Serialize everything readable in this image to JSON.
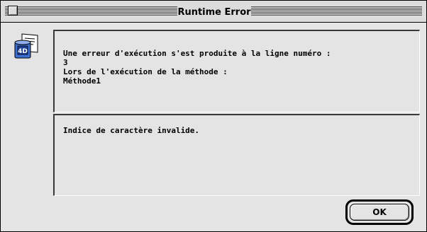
{
  "window": {
    "title": "Runtime Error"
  },
  "icon": {
    "name": "4d-database-icon",
    "glyph": "4D"
  },
  "error": {
    "line_intro": "Une erreur d'exécution s'est produite à la ligne numéro :",
    "line_number": "3",
    "method_intro": "Lors de l'exécution de la méthode :",
    "method_name": "Méthode1",
    "description": "Indice de caractère invalide."
  },
  "buttons": {
    "ok_label": "OK"
  }
}
